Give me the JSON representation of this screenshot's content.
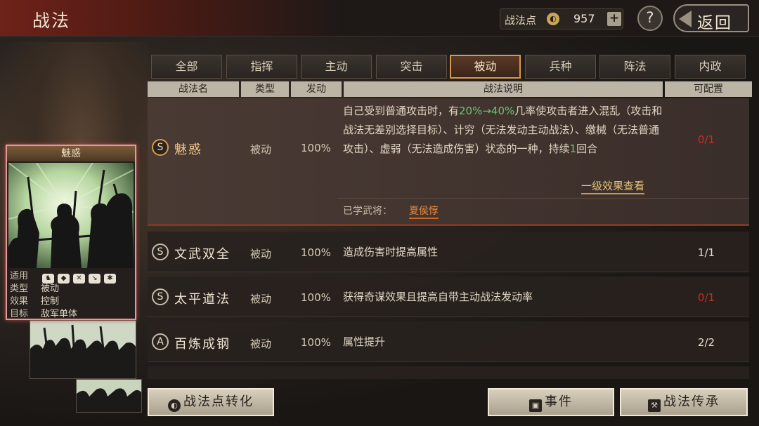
{
  "header": {
    "title": "战法",
    "points_label": "战法点",
    "points_value": "957",
    "plus": "+",
    "help": "?",
    "back_label": "返回"
  },
  "tabs": [
    {
      "label": "全部",
      "active": false
    },
    {
      "label": "指挥",
      "active": false
    },
    {
      "label": "主动",
      "active": false
    },
    {
      "label": "突击",
      "active": false
    },
    {
      "label": "被动",
      "active": true
    },
    {
      "label": "兵种",
      "active": false
    },
    {
      "label": "阵法",
      "active": false
    },
    {
      "label": "内政",
      "active": false
    }
  ],
  "columns": {
    "name": "战法名",
    "type": "类型",
    "rate": "发动",
    "desc": "战法说明",
    "cfg": "可配置"
  },
  "rows": [
    {
      "grade": "S",
      "name": "魅惑",
      "type": "被动",
      "rate": "100%",
      "desc_pre": "自己受到普通攻击时，有",
      "desc_hl": "20%→40%",
      "desc_post": "几率使攻击者进入混乱（攻击和战法无差别选择目标）、计穷（无法发动主动战法）、缴械（无法普通攻击）、虚弱（无法造成伤害）状态的一种，持续",
      "desc_hl2": "1",
      "desc_end": "回合",
      "effect_link": "一级效果查看",
      "learned_label": "已学武将：",
      "learned_name": "夏侯惇",
      "cfg": "0/1",
      "cfg_red": true
    },
    {
      "grade": "S",
      "name": "文武双全",
      "type": "被动",
      "rate": "100%",
      "desc": "造成伤害时提高属性",
      "cfg": "1/1",
      "cfg_red": false
    },
    {
      "grade": "S",
      "name": "太平道法",
      "type": "被动",
      "rate": "100%",
      "desc": "获得奇谋效果且提高自带主动战法发动率",
      "cfg": "0/1",
      "cfg_red": true
    },
    {
      "grade": "A",
      "name": "百炼成钢",
      "type": "被动",
      "rate": "100%",
      "desc": "属性提升",
      "cfg": "2/2",
      "cfg_red": false
    }
  ],
  "card": {
    "title": "魅惑",
    "applicable_label": "适用",
    "unit_icons": [
      "horse-icon",
      "shield-icon",
      "bow-icon",
      "spear-icon",
      "wheel-icon"
    ],
    "type_label": "类型",
    "type_value": "被动",
    "effect_label": "效果",
    "effect_value": "控制",
    "target_label": "目标",
    "target_value": "敌军单体"
  },
  "buttons": {
    "convert": "战法点转化",
    "event": "事件",
    "inherit": "战法传承"
  },
  "colors": {
    "accent": "#d79a4a",
    "highlight_green": "#6ac470",
    "config_red": "#cc2c22",
    "learned_orange": "#e88a3e"
  }
}
